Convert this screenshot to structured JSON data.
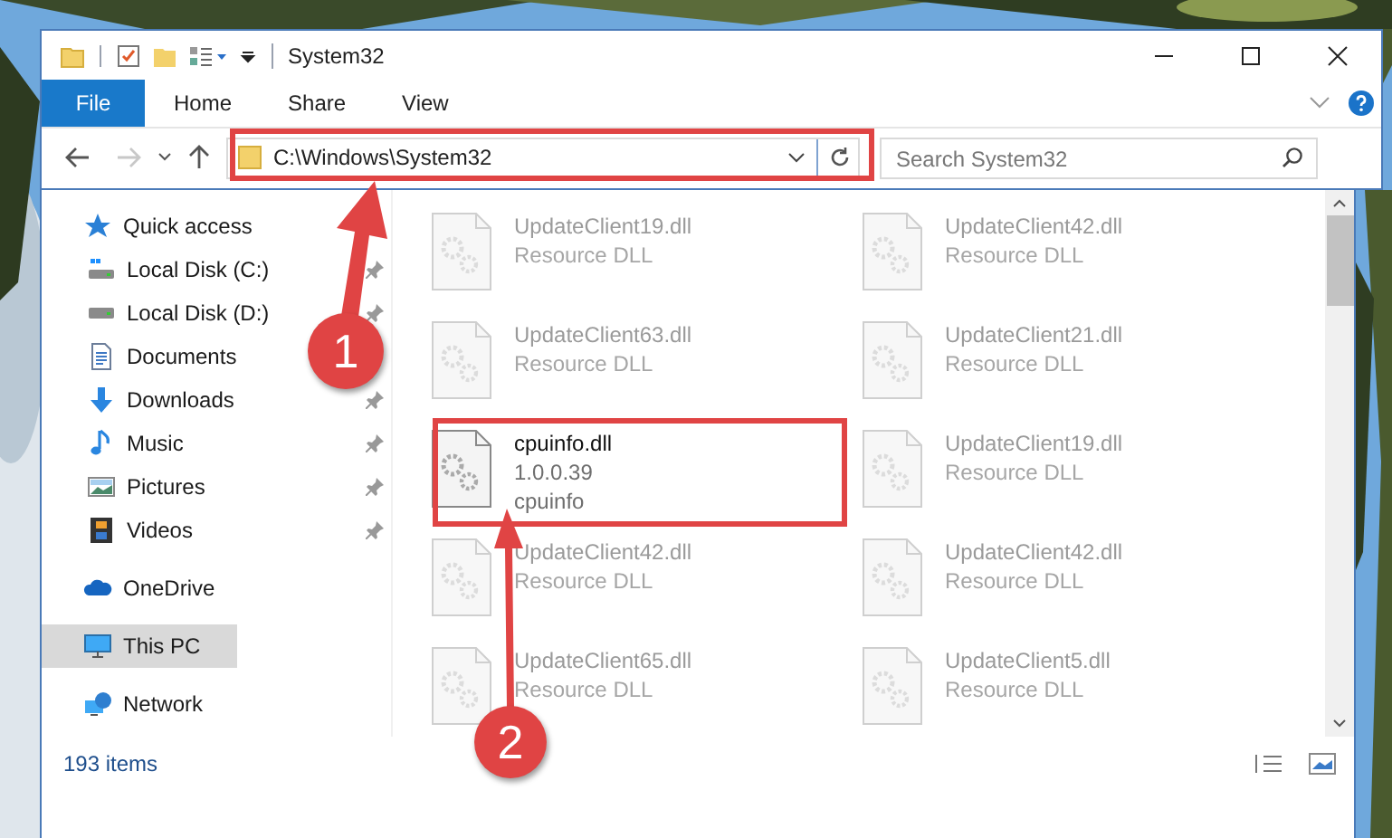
{
  "window": {
    "title": "System32"
  },
  "ribbon_tabs": [
    {
      "label": "File",
      "kind": "file",
      "selected": false
    },
    {
      "label": "Home",
      "kind": "tab",
      "selected": false
    },
    {
      "label": "Share",
      "kind": "tab",
      "selected": false
    },
    {
      "label": "View",
      "kind": "tab",
      "selected": false
    }
  ],
  "address": "C:\\Windows\\System32",
  "search": {
    "placeholder": "Search System32"
  },
  "nav": [
    {
      "label": "Quick access",
      "kind": "quick",
      "selected": false,
      "children": [
        {
          "label": "Local Disk (C:)",
          "kind": "disk_c",
          "pinned": true,
          "selected": false
        },
        {
          "label": "Local Disk (D:)",
          "kind": "disk",
          "pinned": true,
          "selected": false
        },
        {
          "label": "Documents",
          "kind": "documents",
          "pinned": false,
          "selected": false
        },
        {
          "label": "Downloads",
          "kind": "downloads",
          "pinned": true,
          "selected": false
        },
        {
          "label": "Music",
          "kind": "music",
          "pinned": true,
          "selected": false
        },
        {
          "label": "Pictures",
          "kind": "pictures",
          "pinned": true,
          "selected": false
        },
        {
          "label": "Videos",
          "kind": "videos",
          "pinned": true,
          "selected": false
        }
      ]
    },
    {
      "label": "OneDrive",
      "kind": "cloud",
      "selected": false
    },
    {
      "label": "This PC",
      "kind": "pc",
      "selected": true
    },
    {
      "label": "Network",
      "kind": "network",
      "selected": false
    }
  ],
  "files": [
    {
      "name": "UpdateClient19.dll",
      "details": [
        "Resource DLL"
      ],
      "dimmed": true
    },
    {
      "name": "UpdateClient42.dll",
      "details": [
        "Resource DLL"
      ],
      "dimmed": true
    },
    {
      "name": "UpdateClient63.dll",
      "details": [
        "Resource DLL"
      ],
      "dimmed": true
    },
    {
      "name": "UpdateClient21.dll",
      "details": [
        "Resource DLL"
      ],
      "dimmed": true
    },
    {
      "name": "cpuinfo.dll",
      "details": [
        "1.0.0.39",
        "cpuinfo"
      ],
      "dimmed": false
    },
    {
      "name": "UpdateClient19.dll",
      "details": [
        "Resource DLL"
      ],
      "dimmed": true
    },
    {
      "name": "UpdateClient42.dll",
      "details": [
        "Resource DLL"
      ],
      "dimmed": true
    },
    {
      "name": "UpdateClient42.dll",
      "details": [
        "Resource DLL"
      ],
      "dimmed": true
    },
    {
      "name": "UpdateClient65.dll",
      "details": [
        "Resource DLL"
      ],
      "dimmed": true
    },
    {
      "name": "UpdateClient5.dll",
      "details": [
        "Resource DLL"
      ],
      "dimmed": true
    }
  ],
  "status_bar": {
    "item_count": "193 items"
  },
  "annotations": [
    {
      "label": "1"
    },
    {
      "label": "2"
    }
  ]
}
